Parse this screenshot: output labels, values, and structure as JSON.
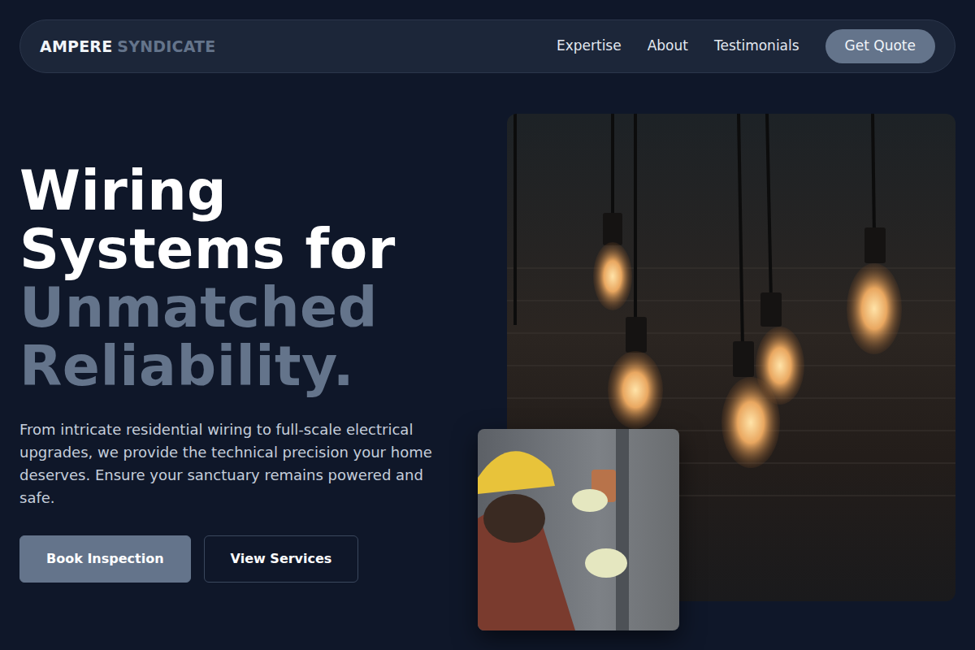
{
  "brand": {
    "first": "AMPERE",
    "second": "SYNDICATE"
  },
  "nav": {
    "links": [
      {
        "label": "Expertise"
      },
      {
        "label": "About"
      },
      {
        "label": "Testimonials"
      }
    ],
    "cta": "Get Quote"
  },
  "hero": {
    "title_lines": [
      {
        "text": "Wiring",
        "color": "#ffffff"
      },
      {
        "text": "Systems for",
        "color": "#ffffff"
      },
      {
        "text": "Unmatched",
        "color": "#64748b"
      },
      {
        "text": "Reliability.",
        "color": "#64748b"
      }
    ],
    "description": "From intricate residential wiring to full-scale electrical upgrades, we provide the technical precision your home deserves. Ensure your sanctuary remains powered and safe.",
    "buttons": [
      {
        "label": "Book Inspection",
        "kind": "primary"
      },
      {
        "label": "View Services",
        "kind": "outline"
      }
    ]
  }
}
